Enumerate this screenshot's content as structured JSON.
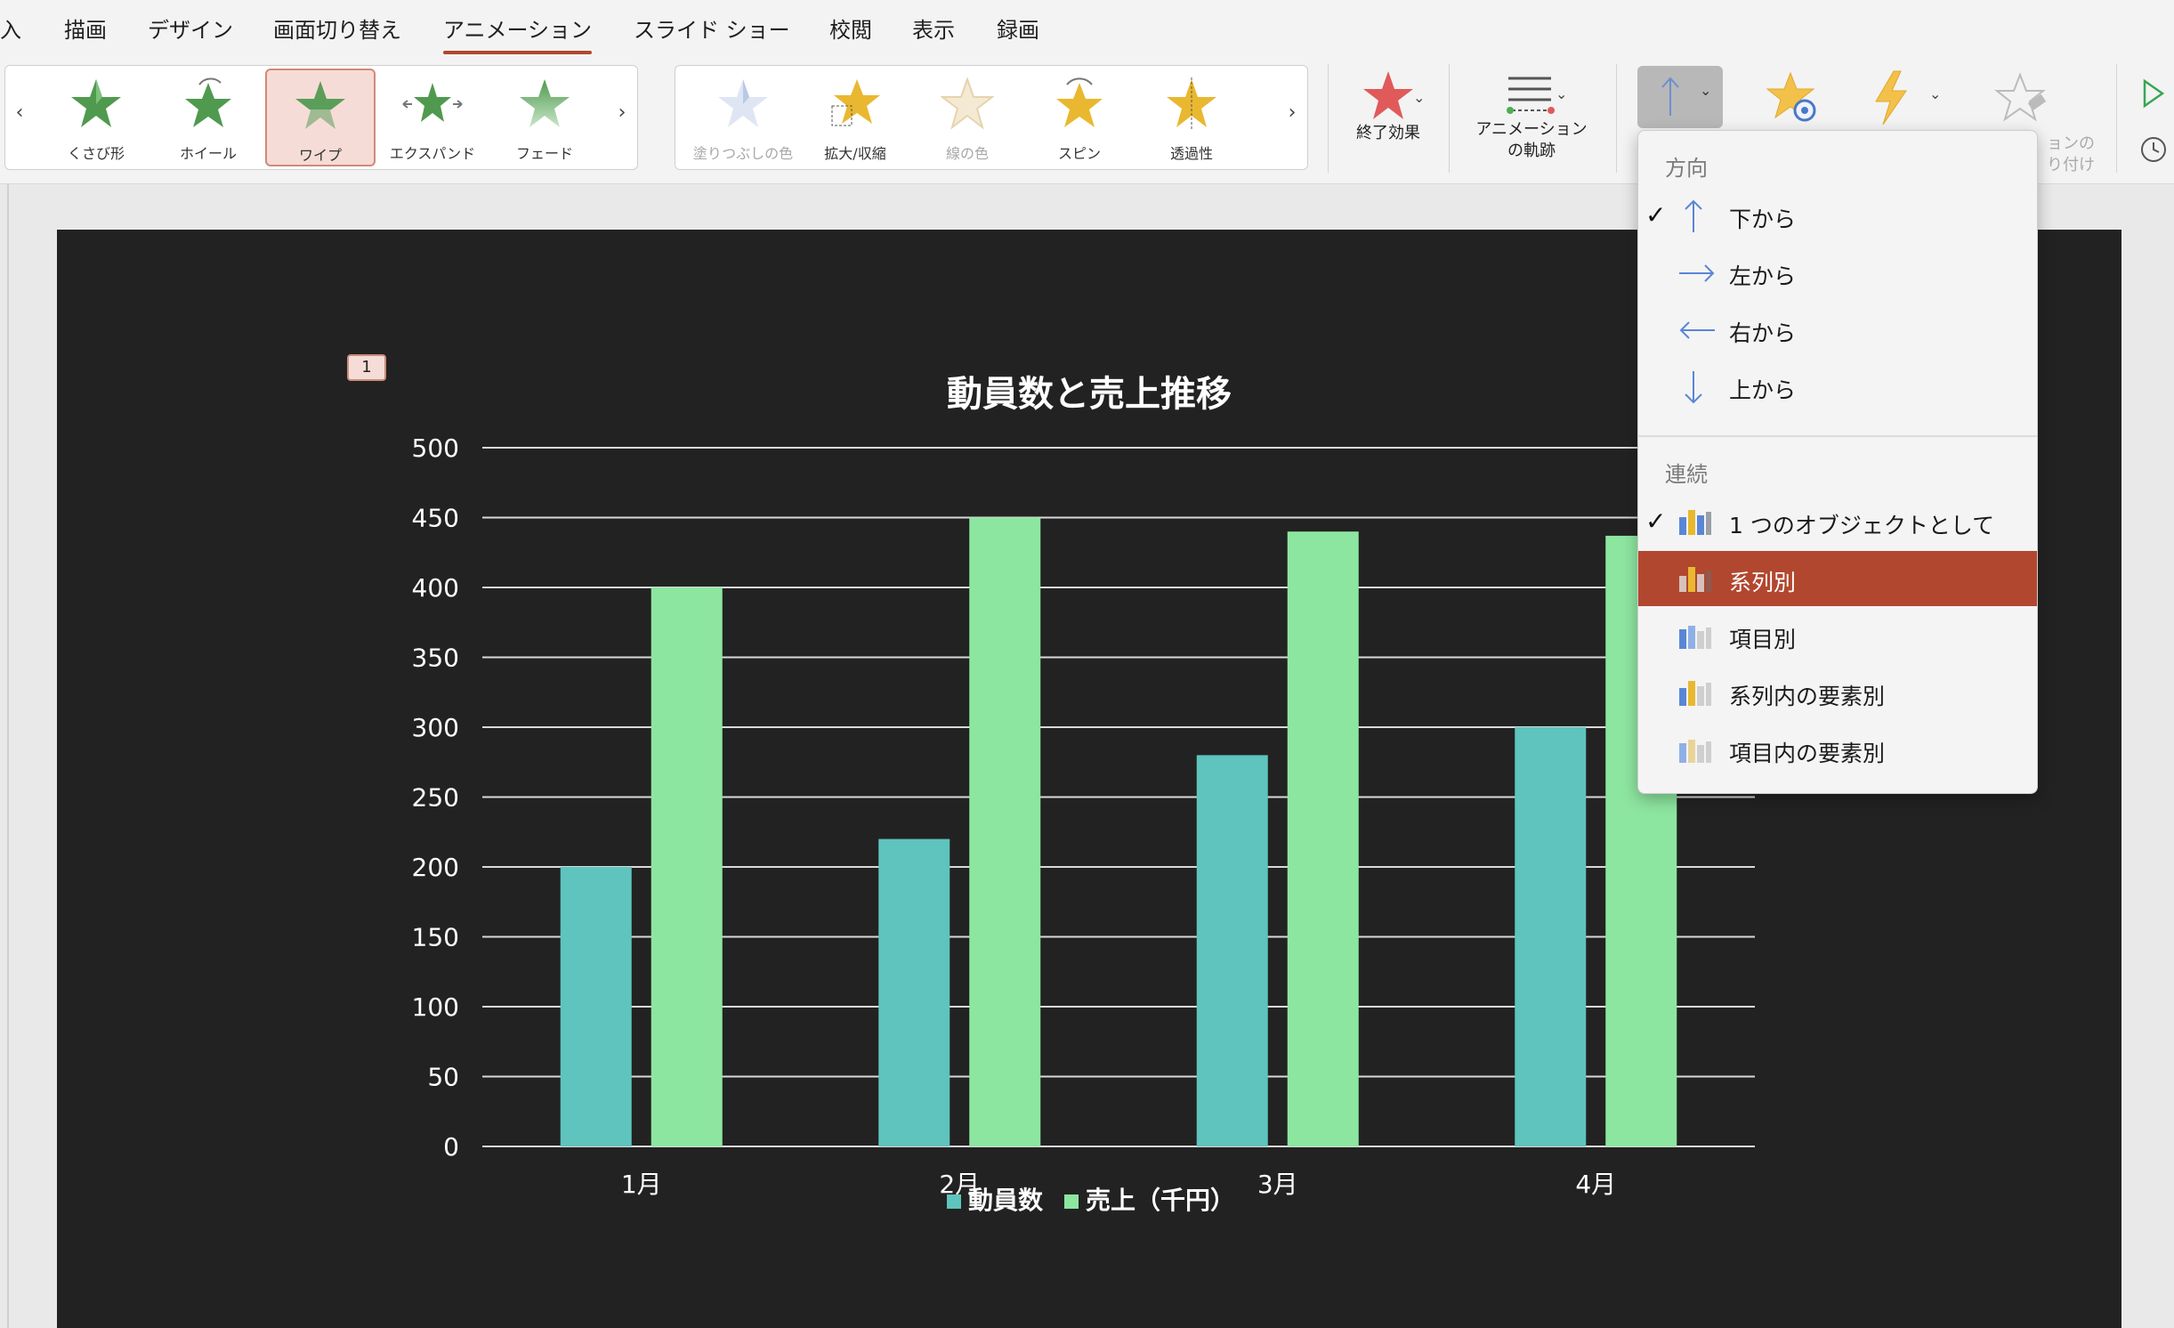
{
  "menu": {
    "tabs": [
      {
        "label": "入"
      },
      {
        "label": "描画"
      },
      {
        "label": "デザイン"
      },
      {
        "label": "画面切り替え"
      },
      {
        "label": "アニメーション"
      },
      {
        "label": "スライド ショー"
      },
      {
        "label": "校閲"
      },
      {
        "label": "表示"
      },
      {
        "label": "録画"
      }
    ],
    "active": "アニメーション"
  },
  "ribbon": {
    "entrance_gallery": [
      {
        "label": "くさび形",
        "icon": "star-wedge-icon"
      },
      {
        "label": "ホイール",
        "icon": "star-wheel-icon"
      },
      {
        "label": "ワイプ",
        "icon": "star-wipe-icon",
        "selected": true
      },
      {
        "label": "エクスパンド",
        "icon": "star-expand-icon"
      },
      {
        "label": "フェード",
        "icon": "star-fade-icon"
      }
    ],
    "emphasis_gallery": [
      {
        "label": "塗りつぶしの色",
        "icon": "star-fill-color-icon",
        "disabled": true
      },
      {
        "label": "拡大/収縮",
        "icon": "star-grow-shrink-icon"
      },
      {
        "label": "線の色",
        "icon": "star-line-color-icon",
        "disabled": true
      },
      {
        "label": "スピン",
        "icon": "star-spin-icon"
      },
      {
        "label": "透過性",
        "icon": "star-transparency-icon"
      }
    ],
    "exit_effect": {
      "label": "終了効果"
    },
    "motion_path": {
      "label_line1": "アニメーション",
      "label_line2": "の軌跡"
    },
    "effect_options_icon": "arrow-up-icon",
    "partial_label_line1": "ョンの",
    "partial_label_line2": "り付け"
  },
  "dropdown": {
    "direction_header": "方向",
    "direction_items": [
      {
        "label": "下から",
        "checked": true,
        "icon": "arrow-up-icon"
      },
      {
        "label": "左から",
        "checked": false,
        "icon": "arrow-right-icon"
      },
      {
        "label": "右から",
        "checked": false,
        "icon": "arrow-left-icon"
      },
      {
        "label": "上から",
        "checked": false,
        "icon": "arrow-down-icon"
      }
    ],
    "sequence_header": "連続",
    "sequence_items": [
      {
        "label": "1 つのオブジェクトとして",
        "checked": true
      },
      {
        "label": "系列別",
        "highlighted": true
      },
      {
        "label": "項目別"
      },
      {
        "label": "系列内の要素別"
      },
      {
        "label": "項目内の要素別"
      }
    ]
  },
  "slide": {
    "animation_tag": "1"
  },
  "colors": {
    "accent": "#b2472f",
    "slide_bg": "#222222",
    "series1": "#5ec4bd",
    "series2": "#8de6a0"
  },
  "chart_data": {
    "type": "bar",
    "title": "動員数と売上推移",
    "categories": [
      "1月",
      "2月",
      "3月",
      "4月"
    ],
    "series": [
      {
        "name": "動員数",
        "values": [
          200,
          220,
          280,
          300
        ]
      },
      {
        "name": "売上（千円）",
        "values": [
          400,
          450,
          440,
          437
        ]
      }
    ],
    "ylim": [
      0,
      500
    ],
    "yticks": [
      "0",
      "50",
      "100",
      "150",
      "200",
      "250",
      "300",
      "350",
      "400",
      "450",
      "500"
    ],
    "grid": true,
    "legend": "bottom"
  }
}
